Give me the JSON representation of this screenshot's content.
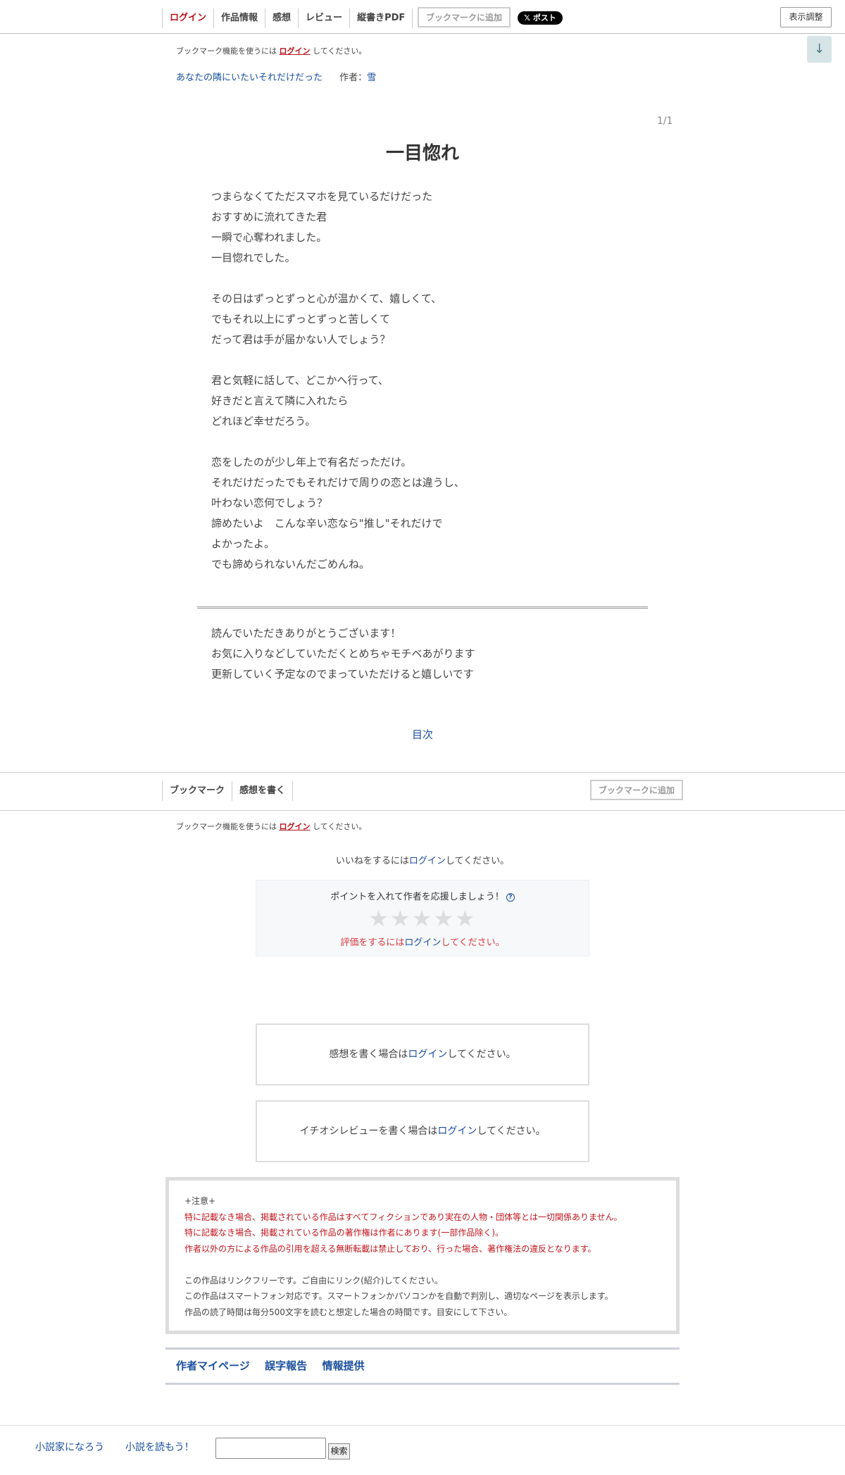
{
  "topnav": {
    "items": [
      {
        "label": "ログイン"
      },
      {
        "label": "作品情報"
      },
      {
        "label": "感想"
      },
      {
        "label": "レビュー"
      },
      {
        "label": "縦書きPDF"
      }
    ],
    "bookmark_button": "ブックマークに追加",
    "x_button": "𝕏 ポスト",
    "display_settings": "表示調整",
    "scroll_down": "↓"
  },
  "bookmark_note": {
    "before": "ブックマーク機能を使うには",
    "link": "ログイン",
    "after": "してください。"
  },
  "series": {
    "title": "あなたの隣にいたいそれだけだった",
    "author_label": "作者：",
    "author": "雪"
  },
  "pager": "1/1",
  "chapter": {
    "title": "一目惚れ",
    "lines": [
      "つまらなくてただスマホを見ているだけだった",
      "おすすめに流れてきた君",
      "一瞬で心奪われました。",
      "一目惚れでした。",
      "",
      "その日はずっとずっと心が温かくて、嬉しくて、",
      "でもそれ以上にずっとずっと苦しくて",
      "だって君は手が届かない人でしょう？",
      "",
      "君と気軽に話して、どこかへ行って、",
      "好きだと言えて隣に入れたら",
      "どれほど幸せだろう。",
      "",
      "恋をしたのが少し年上で有名だっただけ。",
      "それだけだったでもそれだけで周りの恋とは違うし、",
      "叶わない恋何でしょう？",
      "諦めたいよ　こんな辛い恋なら\"推し\"それだけで",
      "よかったよ。",
      "でも諦められないんだごめんね。"
    ],
    "afterword": [
      "読んでいただきありがとうございます！",
      "お気に入りなどしていただくとめちゃモチベあがります",
      "更新していく予定なのでまっていただけると嬉しいです"
    ]
  },
  "toc_label": "目次",
  "bottomnav": {
    "items": [
      {
        "label": "ブックマーク"
      },
      {
        "label": "感想を書く"
      }
    ],
    "bookmark_button": "ブックマークに追加"
  },
  "like": {
    "before": "いいねをするには",
    "link": "ログイン",
    "after": "してください。"
  },
  "points": {
    "title": "ポイントを入れて作者を応援しましょう！",
    "help_icon": "?",
    "stars": "★★★★★",
    "star_count": 5,
    "note_before": "評価をするには",
    "note_link": "ログイン",
    "note_after": "してください。"
  },
  "comment_box": {
    "before": "感想を書く場合は",
    "link": "ログイン",
    "after": "してください。"
  },
  "review_box": {
    "before": "イチオシレビューを書く場合は",
    "link": "ログイン",
    "after": "してください。"
  },
  "notice": {
    "header": "+注意+",
    "red_lines": [
      "特に記載なき場合、掲載されている作品はすべてフィクションであり実在の人物・団体等とは一切関係ありません。",
      "特に記載なき場合、掲載されている作品の著作権は作者にあります(一部作品除く)。",
      "作者以外の方による作品の引用を超える無断転載は禁止しており、行った場合、著作権法の違反となります。"
    ],
    "lines": [
      "この作品はリンクフリーです。ご自由にリンク(紹介)してください。",
      "この作品はスマートフォン対応です。スマートフォンかパソコンかを自動で判別し、適切なページを表示します。",
      "作品の読了時間は毎分500文字を読むと想定した場合の時間です。目安にして下さい。"
    ]
  },
  "links": [
    {
      "label": "作者マイページ"
    },
    {
      "label": "誤字報告"
    },
    {
      "label": "情報提供"
    }
  ],
  "footer": {
    "link1": "小説家になろう",
    "link2": "小説を読もう！",
    "search_value": "",
    "search_button": "検索"
  }
}
